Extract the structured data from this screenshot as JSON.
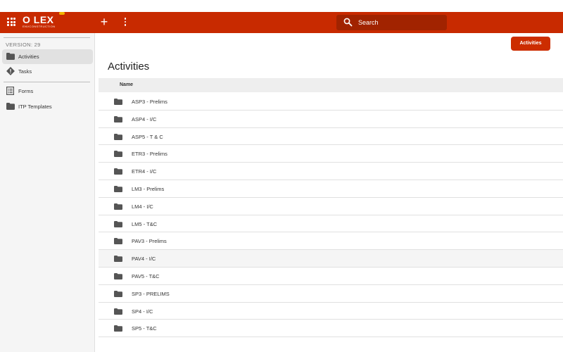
{
  "header": {
    "brand": "O LEX",
    "brand_sub": "ENVCONSTRUCTION",
    "search_placeholder": "Search"
  },
  "sidebar": {
    "version": "VERSION: 29",
    "items": [
      {
        "label": "Activities",
        "icon": "folder-icon",
        "active": true
      },
      {
        "label": "Tasks",
        "icon": "diamond-info-icon",
        "active": false
      },
      {
        "label": "Forms",
        "icon": "form-icon",
        "active": false
      },
      {
        "label": "ITP Templates",
        "icon": "folder-icon",
        "active": false
      }
    ]
  },
  "main": {
    "action_button": "Activities",
    "title": "Activities",
    "column_header": "Name",
    "rows": [
      "ASP3 - Prelims",
      "ASP4 - I/C",
      "ASP5 - T & C",
      "ETR3 - Prelims",
      "ETR4 - I/C",
      "LM3 - Prelims",
      "LM4 - I/C",
      "LM5 - T&C",
      "PAV3 - Prelims",
      "PAV4 - I/C",
      "PAV5 - T&C",
      "SP3 - PRELIMS",
      "SP4 - I/C",
      "SP5 - T&C"
    ],
    "highlighted_row_index": 9
  },
  "colors": {
    "brand_red": "#c82a00",
    "button_red": "#cc2d00",
    "search_bg": "#a12300"
  }
}
